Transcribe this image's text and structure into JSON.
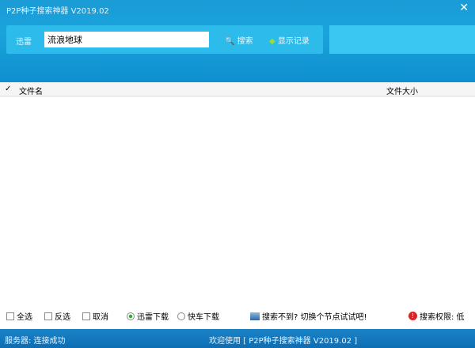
{
  "window": {
    "title": "P2P种子搜索神器 V2019.02",
    "close": "✕"
  },
  "toolbar": {
    "label": "迅雷",
    "search_value": "流浪地球",
    "search_button": "搜索",
    "history_button": "显示记录"
  },
  "table": {
    "check_col": "✓",
    "name_col": "文件名",
    "size_col": "文件大小"
  },
  "bottom": {
    "select_all": "全选",
    "invert": "反选",
    "cancel": "取消",
    "thunder_download": "迅雷下载",
    "express_download": "快车下载",
    "tip": "搜索不到? 切换个节点试试吧!",
    "permission": "搜索权限: 低"
  },
  "status": {
    "server": "服务器: 连接成功",
    "welcome": "欢迎使用 [ P2P种子搜索神器 V2019.02 ]"
  }
}
